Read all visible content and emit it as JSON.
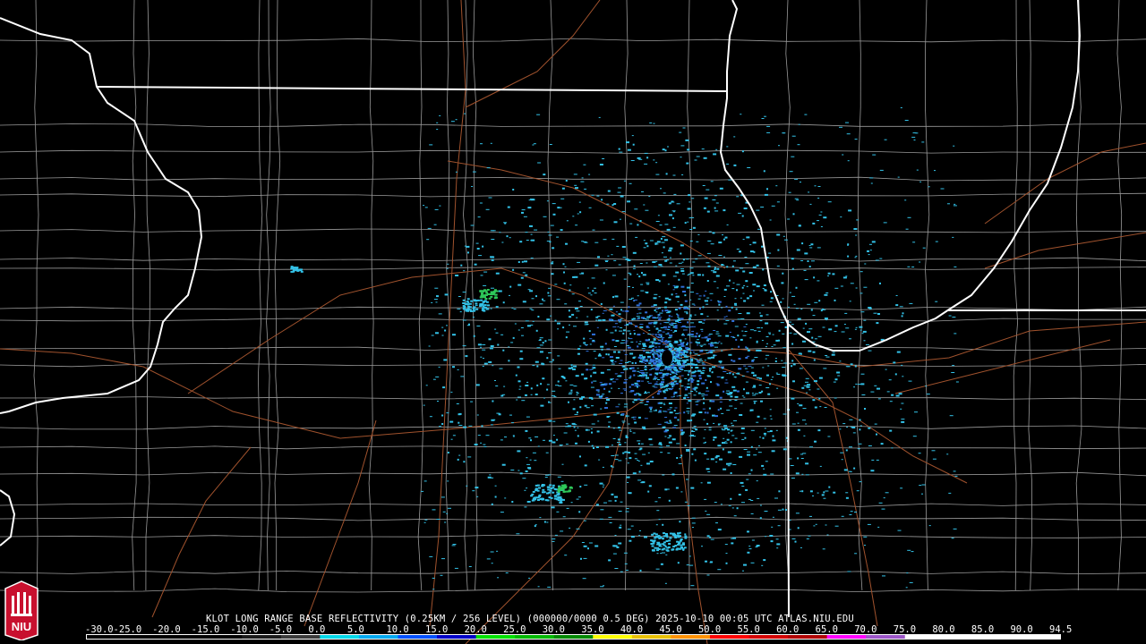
{
  "product": {
    "caption": "KLOT LONG RANGE BASE REFLECTIVITY (0.25KM / 256 LEVEL) (000000/0000 0.5 DEG) 2025-10-10 00:05 UTC  ATLAS.NIU.EDU"
  },
  "scale": {
    "labels": [
      "-30.0",
      "-25.0",
      "-20.0",
      "-15.0",
      "-10.0",
      "-5.0",
      "0.0",
      "5.0",
      "10.0",
      "15.0",
      "20.0",
      "25.0",
      "30.0",
      "35.0",
      "40.0",
      "45.0",
      "50.0",
      "55.0",
      "60.0",
      "65.0",
      "70.0",
      "75.0",
      "80.0",
      "85.0",
      "90.0",
      "94.5"
    ],
    "colors": [
      "#000000",
      "#000000",
      "#000000",
      "#000000",
      "#1a1a1a",
      "#3a3a3a",
      "#00d8e8",
      "#00a8f0",
      "#0050ff",
      "#0000c8",
      "#00e000",
      "#00b800",
      "#008800",
      "#ffff00",
      "#e8c000",
      "#ff9000",
      "#ff0000",
      "#d40000",
      "#b00000",
      "#ff00ff",
      "#9c55c8",
      "#ffffff",
      "#ffffff",
      "#ffffff",
      "#ffffff"
    ]
  },
  "logo": {
    "text": "NIU",
    "colors": {
      "bg": "#c8102e",
      "fg": "#ffffff"
    }
  },
  "map_colors": {
    "background": "#000000",
    "state_lines": "#ffffff",
    "county_lines": "#9a9a9a",
    "roads": "#a0522d",
    "echo_main": "#33c2e8",
    "echo_strong": "#2f6fd8",
    "echo_green": "#2ec85a"
  }
}
